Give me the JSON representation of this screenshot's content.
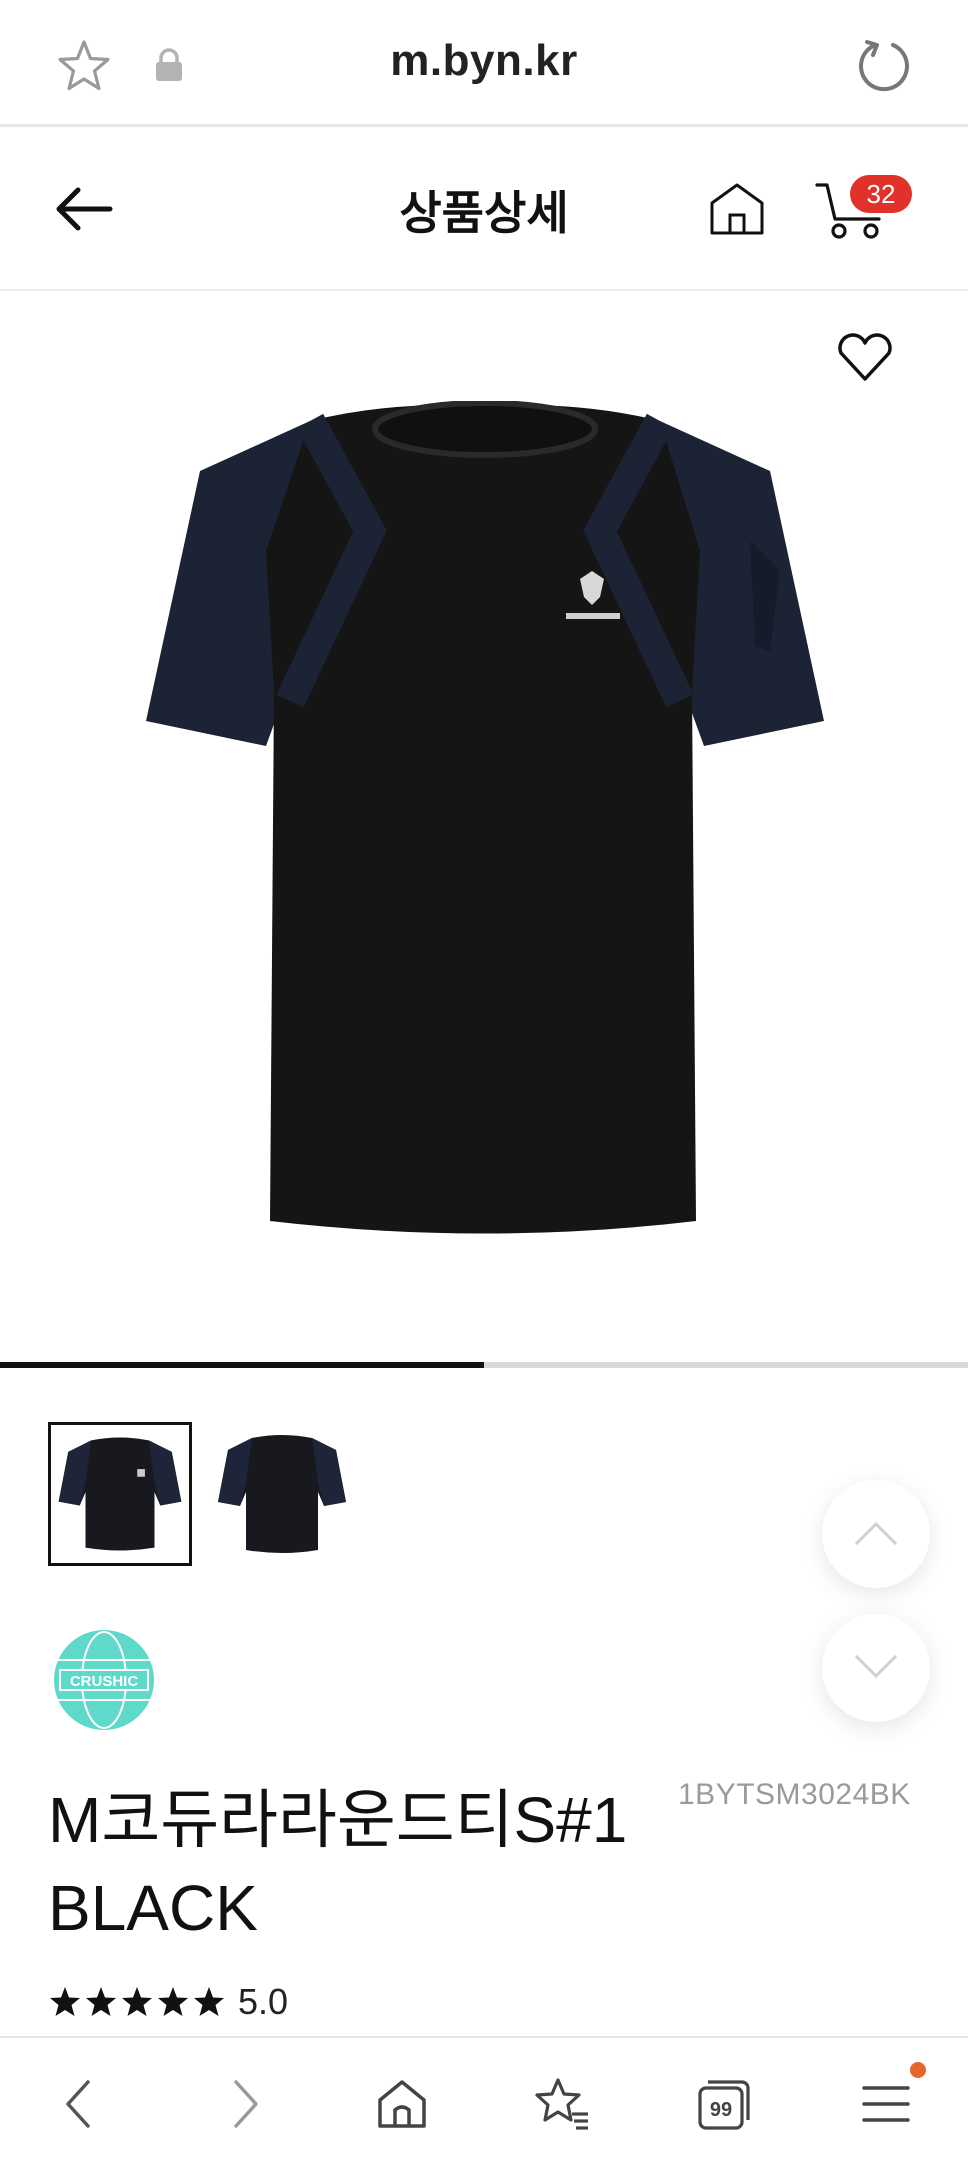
{
  "browser": {
    "url": "m.byn.kr"
  },
  "header": {
    "title": "상품상세",
    "cart_count": "32"
  },
  "gallery": {
    "progress_fraction": 0.5,
    "thumbnails": [
      "front",
      "back"
    ]
  },
  "brand": {
    "logo_text": "CRUSHIC"
  },
  "product": {
    "name": "M코듀라라운드티S#1 BLACK",
    "code": "1BYTSM3024BK",
    "rating_stars": 5,
    "rating": "5.0"
  },
  "icons": {
    "bookmark": "star-outline-icon",
    "secure": "lock-icon",
    "reload": "reload-icon",
    "back": "arrow-left-icon",
    "home": "home-icon",
    "cart": "cart-icon",
    "wishlist": "heart-outline-icon",
    "scroll_up": "chevron-up-icon",
    "scroll_down": "chevron-down-icon"
  },
  "colors": {
    "accent_badge": "#e0312b",
    "notification_dot": "#e8662a",
    "brand_teal": "#5fd9c9"
  }
}
